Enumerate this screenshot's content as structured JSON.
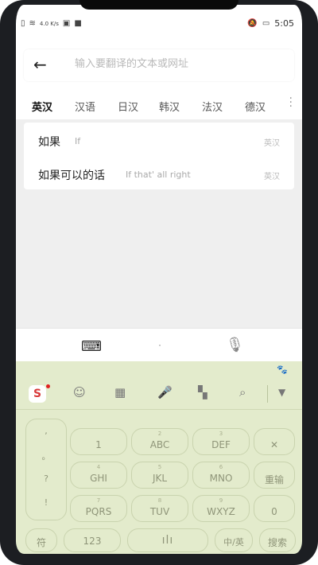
{
  "status": {
    "left_icons": [
      "sim-card",
      "wifi",
      "data-rate",
      "hd",
      "notification"
    ],
    "data_rate": "4.0 K/s",
    "time": "5:05"
  },
  "search": {
    "placeholder": "输入要翻译的文本或网址"
  },
  "tabs": [
    "英汉",
    "汉语",
    "日汉",
    "韩汉",
    "法汉",
    "德汉"
  ],
  "results": [
    {
      "source": "如果",
      "translation": "If",
      "tag": "英汉"
    },
    {
      "source": "如果可以的话",
      "translation": "If that' all right",
      "tag": "英汉"
    }
  ],
  "keyboard": {
    "toolbar": [
      "sogou-logo",
      "emoji-icon",
      "keyboard-icon",
      "mic-icon",
      "apps-icon",
      "search-icon",
      "collapse-icon"
    ],
    "side_symbols": [
      ",",
      "。",
      "?",
      "!"
    ],
    "rows": [
      [
        {
          "main": "1",
          "sub": ""
        },
        {
          "main": "ABC",
          "sub": "2"
        },
        {
          "main": "DEF",
          "sub": "3"
        },
        {
          "main": "✕",
          "sub": ""
        }
      ],
      [
        {
          "main": "GHI",
          "sub": "4"
        },
        {
          "main": "JKL",
          "sub": "5"
        },
        {
          "main": "MNO",
          "sub": "6"
        },
        {
          "main": "重输",
          "sub": ""
        }
      ],
      [
        {
          "main": "PQRS",
          "sub": "7"
        },
        {
          "main": "TUV",
          "sub": "8"
        },
        {
          "main": "WXYZ",
          "sub": "9"
        },
        {
          "main": "0",
          "sub": ""
        }
      ]
    ],
    "bottom": {
      "symbol": "符",
      "num": "123",
      "lang": "中/英",
      "search": "搜索"
    }
  }
}
